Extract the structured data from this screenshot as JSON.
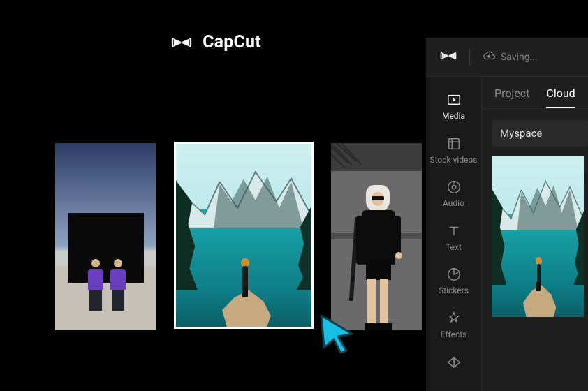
{
  "brand": {
    "name": "CapCut"
  },
  "topbar": {
    "status": "Saving..."
  },
  "tabs": {
    "project": "Project",
    "cloud": "Cloud",
    "active": "cloud"
  },
  "dropdown": {
    "selected": "Myspace"
  },
  "siderail": {
    "media": {
      "label": "Media"
    },
    "stockvideos": {
      "label": "Stock videos"
    },
    "audio": {
      "label": "Audio"
    },
    "text": {
      "label": "Text"
    },
    "stickers": {
      "label": "Stickers"
    },
    "effects": {
      "label": "Effects"
    },
    "transition": {
      "label": ""
    }
  }
}
